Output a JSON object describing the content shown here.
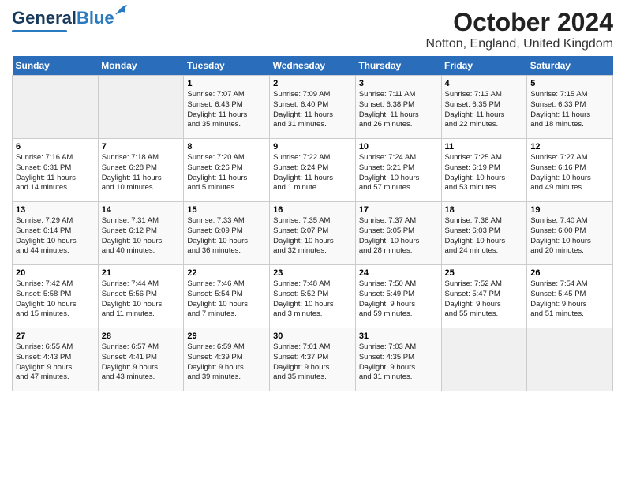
{
  "logo": {
    "line1": "General",
    "line2": "Blue"
  },
  "title": "October 2024",
  "subtitle": "Notton, England, United Kingdom",
  "days_of_week": [
    "Sunday",
    "Monday",
    "Tuesday",
    "Wednesday",
    "Thursday",
    "Friday",
    "Saturday"
  ],
  "weeks": [
    [
      {
        "num": "",
        "info": ""
      },
      {
        "num": "",
        "info": ""
      },
      {
        "num": "1",
        "info": "Sunrise: 7:07 AM\nSunset: 6:43 PM\nDaylight: 11 hours\nand 35 minutes."
      },
      {
        "num": "2",
        "info": "Sunrise: 7:09 AM\nSunset: 6:40 PM\nDaylight: 11 hours\nand 31 minutes."
      },
      {
        "num": "3",
        "info": "Sunrise: 7:11 AM\nSunset: 6:38 PM\nDaylight: 11 hours\nand 26 minutes."
      },
      {
        "num": "4",
        "info": "Sunrise: 7:13 AM\nSunset: 6:35 PM\nDaylight: 11 hours\nand 22 minutes."
      },
      {
        "num": "5",
        "info": "Sunrise: 7:15 AM\nSunset: 6:33 PM\nDaylight: 11 hours\nand 18 minutes."
      }
    ],
    [
      {
        "num": "6",
        "info": "Sunrise: 7:16 AM\nSunset: 6:31 PM\nDaylight: 11 hours\nand 14 minutes."
      },
      {
        "num": "7",
        "info": "Sunrise: 7:18 AM\nSunset: 6:28 PM\nDaylight: 11 hours\nand 10 minutes."
      },
      {
        "num": "8",
        "info": "Sunrise: 7:20 AM\nSunset: 6:26 PM\nDaylight: 11 hours\nand 5 minutes."
      },
      {
        "num": "9",
        "info": "Sunrise: 7:22 AM\nSunset: 6:24 PM\nDaylight: 11 hours\nand 1 minute."
      },
      {
        "num": "10",
        "info": "Sunrise: 7:24 AM\nSunset: 6:21 PM\nDaylight: 10 hours\nand 57 minutes."
      },
      {
        "num": "11",
        "info": "Sunrise: 7:25 AM\nSunset: 6:19 PM\nDaylight: 10 hours\nand 53 minutes."
      },
      {
        "num": "12",
        "info": "Sunrise: 7:27 AM\nSunset: 6:16 PM\nDaylight: 10 hours\nand 49 minutes."
      }
    ],
    [
      {
        "num": "13",
        "info": "Sunrise: 7:29 AM\nSunset: 6:14 PM\nDaylight: 10 hours\nand 44 minutes."
      },
      {
        "num": "14",
        "info": "Sunrise: 7:31 AM\nSunset: 6:12 PM\nDaylight: 10 hours\nand 40 minutes."
      },
      {
        "num": "15",
        "info": "Sunrise: 7:33 AM\nSunset: 6:09 PM\nDaylight: 10 hours\nand 36 minutes."
      },
      {
        "num": "16",
        "info": "Sunrise: 7:35 AM\nSunset: 6:07 PM\nDaylight: 10 hours\nand 32 minutes."
      },
      {
        "num": "17",
        "info": "Sunrise: 7:37 AM\nSunset: 6:05 PM\nDaylight: 10 hours\nand 28 minutes."
      },
      {
        "num": "18",
        "info": "Sunrise: 7:38 AM\nSunset: 6:03 PM\nDaylight: 10 hours\nand 24 minutes."
      },
      {
        "num": "19",
        "info": "Sunrise: 7:40 AM\nSunset: 6:00 PM\nDaylight: 10 hours\nand 20 minutes."
      }
    ],
    [
      {
        "num": "20",
        "info": "Sunrise: 7:42 AM\nSunset: 5:58 PM\nDaylight: 10 hours\nand 15 minutes."
      },
      {
        "num": "21",
        "info": "Sunrise: 7:44 AM\nSunset: 5:56 PM\nDaylight: 10 hours\nand 11 minutes."
      },
      {
        "num": "22",
        "info": "Sunrise: 7:46 AM\nSunset: 5:54 PM\nDaylight: 10 hours\nand 7 minutes."
      },
      {
        "num": "23",
        "info": "Sunrise: 7:48 AM\nSunset: 5:52 PM\nDaylight: 10 hours\nand 3 minutes."
      },
      {
        "num": "24",
        "info": "Sunrise: 7:50 AM\nSunset: 5:49 PM\nDaylight: 9 hours\nand 59 minutes."
      },
      {
        "num": "25",
        "info": "Sunrise: 7:52 AM\nSunset: 5:47 PM\nDaylight: 9 hours\nand 55 minutes."
      },
      {
        "num": "26",
        "info": "Sunrise: 7:54 AM\nSunset: 5:45 PM\nDaylight: 9 hours\nand 51 minutes."
      }
    ],
    [
      {
        "num": "27",
        "info": "Sunrise: 6:55 AM\nSunset: 4:43 PM\nDaylight: 9 hours\nand 47 minutes."
      },
      {
        "num": "28",
        "info": "Sunrise: 6:57 AM\nSunset: 4:41 PM\nDaylight: 9 hours\nand 43 minutes."
      },
      {
        "num": "29",
        "info": "Sunrise: 6:59 AM\nSunset: 4:39 PM\nDaylight: 9 hours\nand 39 minutes."
      },
      {
        "num": "30",
        "info": "Sunrise: 7:01 AM\nSunset: 4:37 PM\nDaylight: 9 hours\nand 35 minutes."
      },
      {
        "num": "31",
        "info": "Sunrise: 7:03 AM\nSunset: 4:35 PM\nDaylight: 9 hours\nand 31 minutes."
      },
      {
        "num": "",
        "info": ""
      },
      {
        "num": "",
        "info": ""
      }
    ]
  ]
}
